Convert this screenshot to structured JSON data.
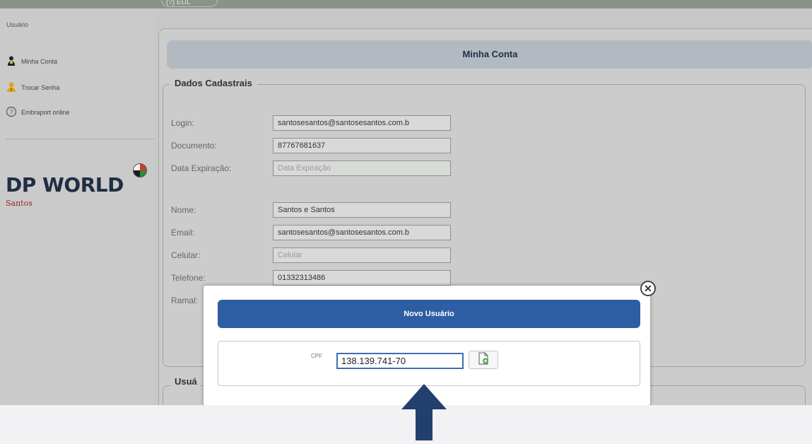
{
  "topbar": {
    "tab_label": "(?) EUL"
  },
  "sidebar": {
    "section_title": "Usuário",
    "items": [
      {
        "label": "Minha Conta",
        "icon": "user-icon"
      },
      {
        "label": "Trocar Senha",
        "icon": "key-user-icon"
      },
      {
        "label": "Embraport online",
        "icon": "help-circle-icon"
      }
    ],
    "logo": {
      "main": "DP WORLD",
      "sub": "Santos"
    }
  },
  "main": {
    "header": "Minha Conta",
    "fieldset_title": "Dados Cadastrais",
    "fields": [
      {
        "label": "Login:",
        "value": "santosesantos@santosesantos.com.b",
        "placeholder": ""
      },
      {
        "label": "Documento:",
        "value": "87767681637",
        "placeholder": ""
      },
      {
        "label": "Data Expiração:",
        "value": "",
        "placeholder": "Data Expiração"
      },
      {
        "label": "Nome:",
        "value": "Santos e Santos",
        "placeholder": ""
      },
      {
        "label": "Email:",
        "value": "santosesantos@santosesantos.com.b",
        "placeholder": ""
      },
      {
        "label": "Celular:",
        "value": "",
        "placeholder": "Celular"
      },
      {
        "label": "Telefone:",
        "value": "01332313486",
        "placeholder": ""
      },
      {
        "label": "Ramal:",
        "value": "",
        "placeholder": ""
      }
    ],
    "second_fieldset_title": "Usuá"
  },
  "modal": {
    "title": "Novo Usuário",
    "cpf_label": "CPF",
    "cpf_value": "138.139.741-70",
    "close_label": "✕"
  },
  "colors": {
    "modal_header": "#2d5ea3",
    "panel_header": "#b3b9c0",
    "arrow": "#22406e"
  }
}
